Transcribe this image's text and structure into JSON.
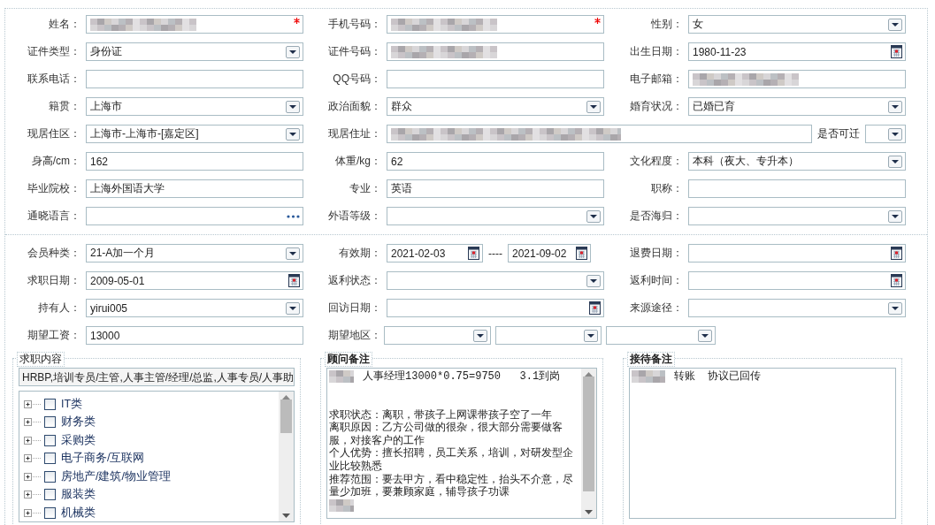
{
  "sections": [
    {
      "rows": [
        [
          {
            "label": "姓名：",
            "kind": "text",
            "redacted": true,
            "required": true
          },
          {
            "label": "手机号码：",
            "kind": "text",
            "redacted": true,
            "required": true
          },
          {
            "label": "性别：",
            "kind": "select",
            "value": "女"
          }
        ],
        [
          {
            "label": "证件类型：",
            "kind": "select",
            "value": "身份证"
          },
          {
            "label": "证件号码：",
            "kind": "text",
            "redacted": true
          },
          {
            "label": "出生日期：",
            "kind": "date",
            "value": "1980-11-23"
          }
        ],
        [
          {
            "label": "联系电话：",
            "kind": "text"
          },
          {
            "label": "QQ号码：",
            "kind": "text"
          },
          {
            "label": "电子邮箱：",
            "kind": "text",
            "redacted": true
          }
        ],
        [
          {
            "label": "籍贯：",
            "kind": "select",
            "value": "上海市"
          },
          {
            "label": "政治面貌：",
            "kind": "select",
            "value": "群众"
          },
          {
            "label": "婚育状况：",
            "kind": "select",
            "value": "已婚已育"
          }
        ],
        [
          {
            "label": "现居住区：",
            "kind": "select",
            "value": "上海市-上海市-[嘉定区]"
          },
          {
            "label": "现居住址：",
            "kind": "text",
            "redacted": true,
            "extra": {
              "label": "是否可迁",
              "kind": "select"
            }
          }
        ],
        [
          {
            "label": "身高/cm：",
            "kind": "text",
            "value": "162"
          },
          {
            "label": "体重/kg：",
            "kind": "text",
            "value": "62"
          },
          {
            "label": "文化程度：",
            "kind": "select",
            "value": "本科（夜大、专升本）"
          }
        ],
        [
          {
            "label": "毕业院校：",
            "kind": "text",
            "value": "上海外国语大学"
          },
          {
            "label": "专业：",
            "kind": "text",
            "value": "英语"
          },
          {
            "label": "职称：",
            "kind": "text"
          }
        ],
        [
          {
            "label": "通晓语言：",
            "kind": "picker"
          },
          {
            "label": "外语等级：",
            "kind": "select"
          },
          {
            "label": "是否海归：",
            "kind": "select"
          }
        ]
      ]
    },
    {
      "rows": [
        [
          {
            "label": "会员种类：",
            "kind": "select",
            "value": "21-A加一个月"
          },
          {
            "label": "有效期：",
            "kind": "date-range",
            "from": "2021-02-03",
            "separator": "----",
            "to": "2021-09-02"
          },
          {
            "label": "退费日期：",
            "kind": "date"
          }
        ],
        [
          {
            "label": "求职日期：",
            "kind": "date",
            "value": "2009-05-01"
          },
          {
            "label": "返利状态：",
            "kind": "select"
          },
          {
            "label": "返利时间：",
            "kind": "date"
          }
        ],
        [
          {
            "label": "持有人：",
            "kind": "select",
            "value": "yirui005"
          },
          {
            "label": "回访日期：",
            "kind": "date"
          },
          {
            "label": "来源途径：",
            "kind": "select"
          }
        ],
        [
          {
            "label": "期望工资：",
            "kind": "text",
            "value": "13000"
          },
          {
            "label": "期望地区：",
            "kind": "select-group",
            "options": [
              {
                "kind": "select"
              },
              {
                "kind": "select"
              },
              {
                "kind": "select"
              }
            ]
          }
        ]
      ]
    }
  ],
  "groups": [
    {
      "title": "求职内容",
      "kind": "tree",
      "summary": "HRBP,培训专员/主管,人事主管/经理/总监,人事专员/人事助",
      "items": [
        {
          "label": "IT类",
          "checked": false
        },
        {
          "label": "财务类",
          "checked": false
        },
        {
          "label": "采购类",
          "checked": false
        },
        {
          "label": "电子商务/互联网",
          "checked": false
        },
        {
          "label": "房地产/建筑/物业管理",
          "checked": false
        },
        {
          "label": "服装类",
          "checked": false
        },
        {
          "label": "机械类",
          "checked": false
        }
      ]
    },
    {
      "title": "顾问备注",
      "kind": "note",
      "scrollable": true,
      "lines": [
        {
          "redacted": true,
          "text": "人事经理13000*0.75=9750   3.1到岗"
        },
        {
          "space_before": true,
          "text": "求职状态：离职，带孩子上网课带孩子空了一年"
        },
        {
          "text": "离职原因：乙方公司做的很杂，很大部分需要做客"
        },
        {
          "text": "服，对接客户的工作"
        },
        {
          "text": "个人优势：擅长招聘，员工关系，培训，对研发型企"
        },
        {
          "text": "业比较熟悉"
        },
        {
          "text": "推荐范围：要去甲方，看中稳定性，抬头不介意，尽"
        },
        {
          "text": "量少加班，要兼顾家庭，辅导孩子功课"
        },
        {
          "redacted": true
        }
      ]
    },
    {
      "title": "接待备注",
      "kind": "note",
      "scrollable": false,
      "lines": [
        {
          "redacted": true,
          "text": "转账  协议已回传"
        }
      ]
    }
  ]
}
